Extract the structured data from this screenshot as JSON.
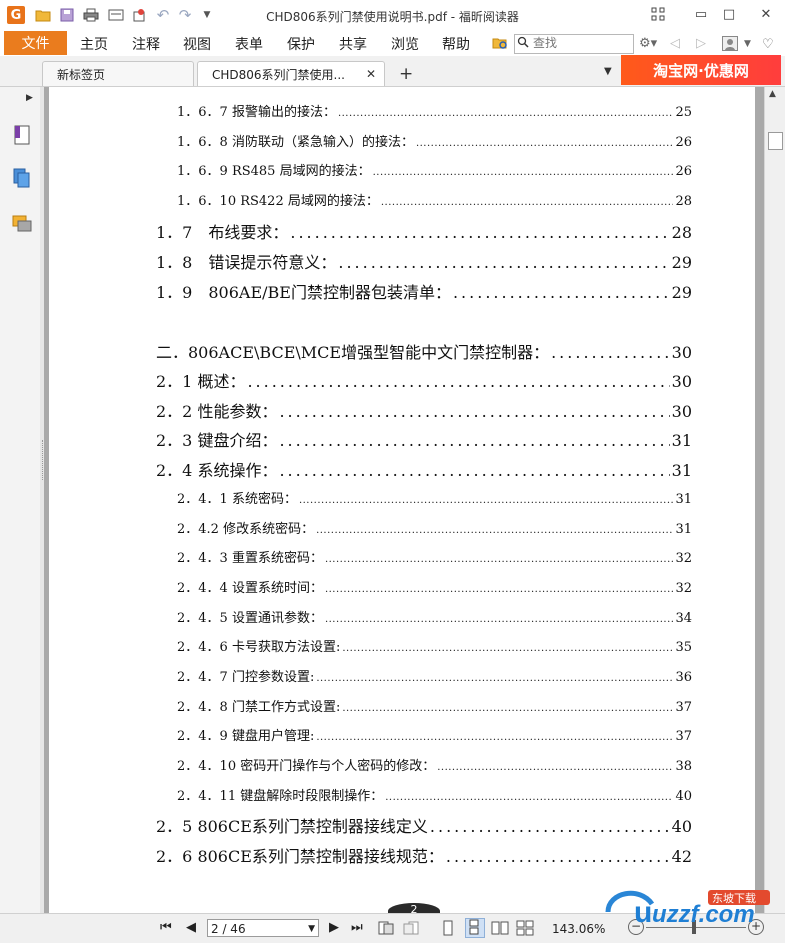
{
  "window": {
    "title": "CHD806系列门禁使用说明书.pdf - 福昕阅读器",
    "app_logo": "G",
    "controls": {
      "minimize": "▭",
      "maximize": "□",
      "close": "✕"
    }
  },
  "quick_access": {
    "icons": [
      "open-folder-icon",
      "save-icon",
      "print-icon",
      "scan-icon",
      "stamp-icon",
      "undo-icon",
      "redo-icon",
      "customize-dropdown-icon"
    ]
  },
  "menu": {
    "file_label": "文件",
    "items": [
      "主页",
      "注释",
      "视图",
      "表单",
      "保护",
      "共享",
      "浏览",
      "帮助"
    ],
    "search_placeholder": "查找"
  },
  "tabs": [
    {
      "label": "新标签页"
    },
    {
      "label": "CHD806系列门禁使用...",
      "close": "✕"
    }
  ],
  "new_tab_symbol": "+",
  "ad": {
    "text": "淘宝网·优惠网"
  },
  "toc": [
    {
      "label": "1．6．7 报警输出的接法：",
      "page": "25",
      "level": 3
    },
    {
      "label": "1．6．8 消防联动（紧急输入）的接法：",
      "page": "26",
      "level": 3
    },
    {
      "label": "1．6．9 RS485 局域网的接法：",
      "page": "26",
      "level": 3
    },
    {
      "label": "1．6．10 RS422 局域网的接法：",
      "page": "28",
      "level": 3
    },
    {
      "label": "1．7　布线要求：",
      "page": "28",
      "level": 2
    },
    {
      "label": "1．8　错误提示符意义：",
      "page": "29",
      "level": 2
    },
    {
      "label": "1．9　806AE/BE门禁控制器包装清单：",
      "page": "29",
      "level": 2
    },
    {
      "label": "二．806ACE\\BCE\\MCE增强型智能中文门禁控制器：",
      "page": "30",
      "level": 2
    },
    {
      "label": "2．1 概述：",
      "page": "30",
      "level": 2
    },
    {
      "label": "2．2 性能参数：",
      "page": "30",
      "level": 2
    },
    {
      "label": "2．3 键盘介绍：",
      "page": "31",
      "level": 2
    },
    {
      "label": "2．4 系统操作：",
      "page": "31",
      "level": 2
    },
    {
      "label": "2．4．1 系统密码：",
      "page": "31",
      "level": 3
    },
    {
      "label": "2．4.2 修改系统密码：",
      "page": "31",
      "level": 3
    },
    {
      "label": "2．4．3 重置系统密码：",
      "page": "32",
      "level": 3
    },
    {
      "label": "2．4．4 设置系统时间：",
      "page": "32",
      "level": 3
    },
    {
      "label": "2．4．5 设置通讯参数：",
      "page": "34",
      "level": 3
    },
    {
      "label": "2．4．6 卡号获取方法设置:",
      "page": "35",
      "level": 3
    },
    {
      "label": "2．4．7 门控参数设置:",
      "page": "36",
      "level": 3
    },
    {
      "label": "2．4．8 门禁工作方式设置:",
      "page": "37",
      "level": 3
    },
    {
      "label": "2．4．9 键盘用户管理:",
      "page": "37",
      "level": 3
    },
    {
      "label": "2．4．10 密码开门操作与个人密码的修改：",
      "page": "38",
      "level": 3
    },
    {
      "label": "2．4．11 键盘解除时段限制操作：",
      "page": "40",
      "level": 3
    },
    {
      "label": "2．5 806CE系列门禁控制器接线定义",
      "page": "40",
      "level": 2
    },
    {
      "label": "2．6 806CE系列门禁控制器接线规范：",
      "page": "42",
      "level": 2
    }
  ],
  "page_badge": "2",
  "status": {
    "page_field": "2 / 46",
    "zoom": "143.06%"
  },
  "watermark": {
    "text": "uzzf.com",
    "tag": "东坡下载"
  }
}
